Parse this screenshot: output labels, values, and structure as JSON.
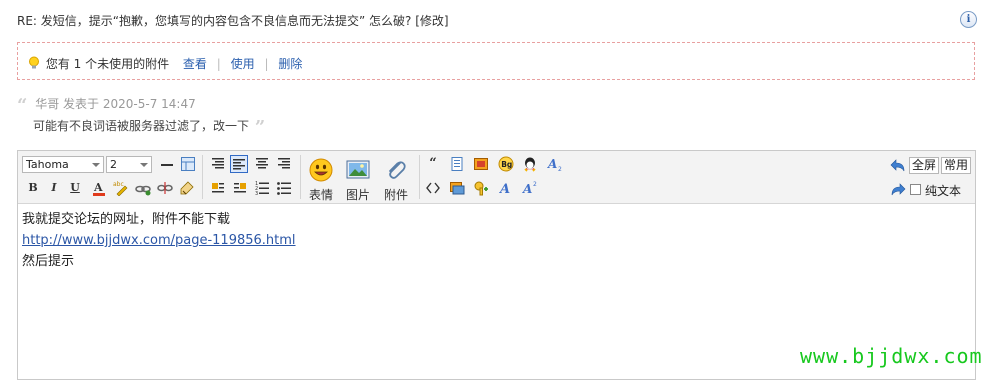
{
  "post": {
    "title": "RE: 发短信，提示“抱歉，您填写的内容包含不良信息而无法提交” 怎么破? [修改]"
  },
  "attachment_notice": {
    "text": "您有 1 个未使用的附件",
    "view_label": "查看",
    "use_label": "使用",
    "delete_label": "删除",
    "separator": "|"
  },
  "quote": {
    "author": "华哥",
    "posted_label": "发表于",
    "datetime": "2020-5-7 14:47",
    "body": "可能有不良词语被服务器过滤了，改一下",
    "open_mark": "“",
    "close_mark": "”"
  },
  "toolbar": {
    "font_family": "Tahoma",
    "font_size": "2",
    "emoticon_label": "表情",
    "image_label": "图片",
    "attachment_label": "附件",
    "fullscreen_label": "全屏",
    "normal_label": "常用",
    "plaintext_label": "纯文本"
  },
  "editor": {
    "line1": "我就提交论坛的网址，附件不能下载",
    "link": "http://www.bjjdwx.com/page-119856.html",
    "line3": "然后提示"
  },
  "watermark": "www.bjjdwx.com"
}
